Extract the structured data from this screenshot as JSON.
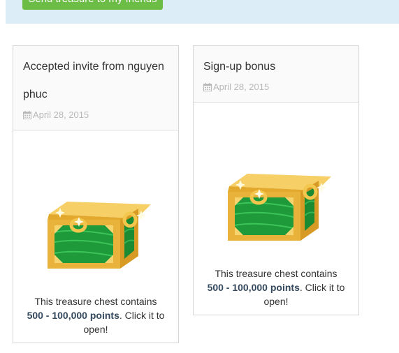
{
  "banner": {
    "send_button_label": "Send treasure to my friends"
  },
  "cards": [
    {
      "title_line1": "Accepted invite from nguyen",
      "title_line2": "phuc",
      "date": "April 28, 2015",
      "text_before": "This treasure chest contains",
      "points": "500 - 100,000 points",
      "text_after": ". Click it to",
      "text_end": "open!"
    },
    {
      "title_line1": "Sign-up bonus",
      "date": "April 28, 2015",
      "text_before": "This treasure chest contains",
      "points": "500 - 100,000 points",
      "text_after": ". Click it to",
      "text_end": "open!"
    }
  ],
  "icons": {
    "date": "calendar-icon",
    "chest": "treasure-chest-icon"
  },
  "colors": {
    "banner_bg": "#dcedf8",
    "button_green": "#6cbd45",
    "chest_gold": "#f2c04a",
    "chest_green": "#1f9a3a"
  }
}
